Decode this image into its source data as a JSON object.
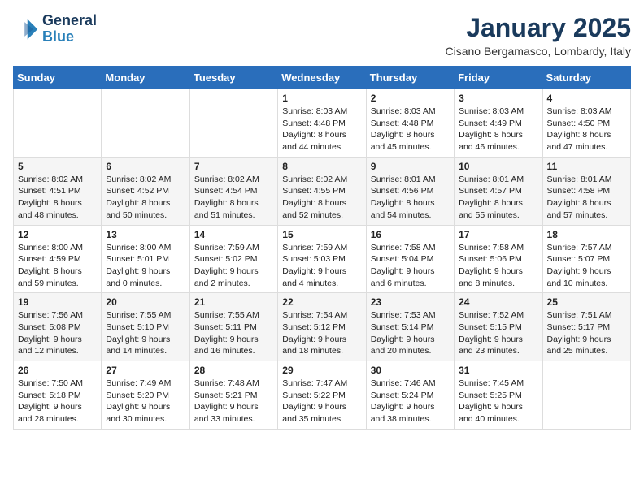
{
  "logo": {
    "line1": "General",
    "line2": "Blue"
  },
  "title": "January 2025",
  "subtitle": "Cisano Bergamasco, Lombardy, Italy",
  "weekdays": [
    "Sunday",
    "Monday",
    "Tuesday",
    "Wednesday",
    "Thursday",
    "Friday",
    "Saturday"
  ],
  "weeks": [
    [
      {
        "day": "",
        "info": ""
      },
      {
        "day": "",
        "info": ""
      },
      {
        "day": "",
        "info": ""
      },
      {
        "day": "1",
        "info": "Sunrise: 8:03 AM\nSunset: 4:48 PM\nDaylight: 8 hours\nand 44 minutes."
      },
      {
        "day": "2",
        "info": "Sunrise: 8:03 AM\nSunset: 4:48 PM\nDaylight: 8 hours\nand 45 minutes."
      },
      {
        "day": "3",
        "info": "Sunrise: 8:03 AM\nSunset: 4:49 PM\nDaylight: 8 hours\nand 46 minutes."
      },
      {
        "day": "4",
        "info": "Sunrise: 8:03 AM\nSunset: 4:50 PM\nDaylight: 8 hours\nand 47 minutes."
      }
    ],
    [
      {
        "day": "5",
        "info": "Sunrise: 8:02 AM\nSunset: 4:51 PM\nDaylight: 8 hours\nand 48 minutes."
      },
      {
        "day": "6",
        "info": "Sunrise: 8:02 AM\nSunset: 4:52 PM\nDaylight: 8 hours\nand 50 minutes."
      },
      {
        "day": "7",
        "info": "Sunrise: 8:02 AM\nSunset: 4:54 PM\nDaylight: 8 hours\nand 51 minutes."
      },
      {
        "day": "8",
        "info": "Sunrise: 8:02 AM\nSunset: 4:55 PM\nDaylight: 8 hours\nand 52 minutes."
      },
      {
        "day": "9",
        "info": "Sunrise: 8:01 AM\nSunset: 4:56 PM\nDaylight: 8 hours\nand 54 minutes."
      },
      {
        "day": "10",
        "info": "Sunrise: 8:01 AM\nSunset: 4:57 PM\nDaylight: 8 hours\nand 55 minutes."
      },
      {
        "day": "11",
        "info": "Sunrise: 8:01 AM\nSunset: 4:58 PM\nDaylight: 8 hours\nand 57 minutes."
      }
    ],
    [
      {
        "day": "12",
        "info": "Sunrise: 8:00 AM\nSunset: 4:59 PM\nDaylight: 8 hours\nand 59 minutes."
      },
      {
        "day": "13",
        "info": "Sunrise: 8:00 AM\nSunset: 5:01 PM\nDaylight: 9 hours\nand 0 minutes."
      },
      {
        "day": "14",
        "info": "Sunrise: 7:59 AM\nSunset: 5:02 PM\nDaylight: 9 hours\nand 2 minutes."
      },
      {
        "day": "15",
        "info": "Sunrise: 7:59 AM\nSunset: 5:03 PM\nDaylight: 9 hours\nand 4 minutes."
      },
      {
        "day": "16",
        "info": "Sunrise: 7:58 AM\nSunset: 5:04 PM\nDaylight: 9 hours\nand 6 minutes."
      },
      {
        "day": "17",
        "info": "Sunrise: 7:58 AM\nSunset: 5:06 PM\nDaylight: 9 hours\nand 8 minutes."
      },
      {
        "day": "18",
        "info": "Sunrise: 7:57 AM\nSunset: 5:07 PM\nDaylight: 9 hours\nand 10 minutes."
      }
    ],
    [
      {
        "day": "19",
        "info": "Sunrise: 7:56 AM\nSunset: 5:08 PM\nDaylight: 9 hours\nand 12 minutes."
      },
      {
        "day": "20",
        "info": "Sunrise: 7:55 AM\nSunset: 5:10 PM\nDaylight: 9 hours\nand 14 minutes."
      },
      {
        "day": "21",
        "info": "Sunrise: 7:55 AM\nSunset: 5:11 PM\nDaylight: 9 hours\nand 16 minutes."
      },
      {
        "day": "22",
        "info": "Sunrise: 7:54 AM\nSunset: 5:12 PM\nDaylight: 9 hours\nand 18 minutes."
      },
      {
        "day": "23",
        "info": "Sunrise: 7:53 AM\nSunset: 5:14 PM\nDaylight: 9 hours\nand 20 minutes."
      },
      {
        "day": "24",
        "info": "Sunrise: 7:52 AM\nSunset: 5:15 PM\nDaylight: 9 hours\nand 23 minutes."
      },
      {
        "day": "25",
        "info": "Sunrise: 7:51 AM\nSunset: 5:17 PM\nDaylight: 9 hours\nand 25 minutes."
      }
    ],
    [
      {
        "day": "26",
        "info": "Sunrise: 7:50 AM\nSunset: 5:18 PM\nDaylight: 9 hours\nand 28 minutes."
      },
      {
        "day": "27",
        "info": "Sunrise: 7:49 AM\nSunset: 5:20 PM\nDaylight: 9 hours\nand 30 minutes."
      },
      {
        "day": "28",
        "info": "Sunrise: 7:48 AM\nSunset: 5:21 PM\nDaylight: 9 hours\nand 33 minutes."
      },
      {
        "day": "29",
        "info": "Sunrise: 7:47 AM\nSunset: 5:22 PM\nDaylight: 9 hours\nand 35 minutes."
      },
      {
        "day": "30",
        "info": "Sunrise: 7:46 AM\nSunset: 5:24 PM\nDaylight: 9 hours\nand 38 minutes."
      },
      {
        "day": "31",
        "info": "Sunrise: 7:45 AM\nSunset: 5:25 PM\nDaylight: 9 hours\nand 40 minutes."
      },
      {
        "day": "",
        "info": ""
      }
    ]
  ]
}
